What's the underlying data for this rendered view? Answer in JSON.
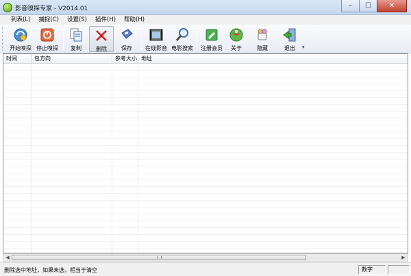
{
  "window": {
    "title": "影音嗅探专家 - V2014.01",
    "controls": {
      "minimize": "–",
      "maximize": "☐",
      "close": "✕"
    }
  },
  "menu": [
    "列表(L)",
    "捕捉(C)",
    "设置(S)",
    "插件(H)",
    "帮助(H)"
  ],
  "toolbar": {
    "buttons": [
      {
        "label": "开始嗅探",
        "icon": "start-sniff-icon"
      },
      {
        "label": "停止嗅探",
        "icon": "stop-sniff-icon"
      },
      {
        "label": "复制",
        "icon": "copy-icon"
      },
      {
        "label": "删除",
        "icon": "delete-icon"
      },
      {
        "label": "保存",
        "icon": "save-icon"
      },
      {
        "label": "在线影音",
        "icon": "online-video-icon"
      },
      {
        "label": "电影搜索",
        "icon": "search-icon"
      },
      {
        "label": "注册会员",
        "icon": "register-icon"
      },
      {
        "label": "关于",
        "icon": "about-icon"
      },
      {
        "label": "隐藏",
        "icon": "hide-icon"
      },
      {
        "label": "退出",
        "icon": "exit-icon"
      }
    ],
    "overflow": "▾"
  },
  "table": {
    "columns": [
      "时间",
      "包方向",
      "参考大小",
      "地址"
    ],
    "rows": []
  },
  "scrollbar": {
    "left_arrow": "◀",
    "right_arrow": "▶"
  },
  "status": {
    "message": "删除选中地址，如果未选，相当于清空",
    "panel_numlock": "数字",
    "panel_empty": ""
  },
  "colors": {
    "close_button": "#c2412d",
    "accent": "#4f9a12",
    "toolbar_bg": "#e8ecf3"
  }
}
